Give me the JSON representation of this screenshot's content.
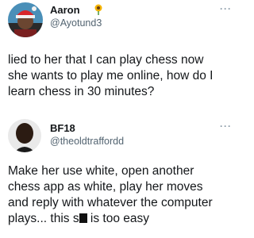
{
  "tweets": [
    {
      "author": {
        "name": "Aaron",
        "handle": "@Ayotund3",
        "badge_icon": "sunflower-icon"
      },
      "more_label": "···",
      "lines": [
        "lied to her that I can play chess now",
        "she wants to play me online, how do I",
        "learn chess in 30 minutes?"
      ]
    },
    {
      "author": {
        "name": "BF18",
        "handle": "@theoldtraffordd"
      },
      "more_label": "···",
      "lines": [
        "Make her use white, open another",
        "chess app as white, play her moves",
        "and reply with whatever the computer"
      ],
      "last_line": {
        "before": "plays... this s",
        "after": " is too easy"
      }
    }
  ]
}
